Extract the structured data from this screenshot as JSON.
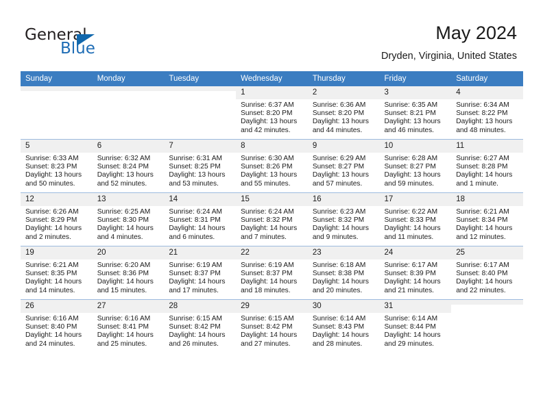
{
  "brand": {
    "name_top": "General",
    "name_bottom": "Blue",
    "accent_color": "#1168ad"
  },
  "header": {
    "month_title": "May 2024",
    "location": "Dryden, Virginia, United States",
    "header_bg": "#3b7dc1"
  },
  "weekdays": [
    "Sunday",
    "Monday",
    "Tuesday",
    "Wednesday",
    "Thursday",
    "Friday",
    "Saturday"
  ],
  "labels": {
    "sunrise": "Sunrise:",
    "sunset": "Sunset:",
    "daylight": "Daylight:"
  },
  "weeks": [
    [
      {
        "day": "",
        "sunrise": "",
        "sunset": "",
        "daylight": "",
        "empty": true
      },
      {
        "day": "",
        "sunrise": "",
        "sunset": "",
        "daylight": "",
        "empty": true
      },
      {
        "day": "",
        "sunrise": "",
        "sunset": "",
        "daylight": "",
        "empty": true
      },
      {
        "day": "1",
        "sunrise": "Sunrise: 6:37 AM",
        "sunset": "Sunset: 8:20 PM",
        "daylight": "Daylight: 13 hours and 42 minutes."
      },
      {
        "day": "2",
        "sunrise": "Sunrise: 6:36 AM",
        "sunset": "Sunset: 8:20 PM",
        "daylight": "Daylight: 13 hours and 44 minutes."
      },
      {
        "day": "3",
        "sunrise": "Sunrise: 6:35 AM",
        "sunset": "Sunset: 8:21 PM",
        "daylight": "Daylight: 13 hours and 46 minutes."
      },
      {
        "day": "4",
        "sunrise": "Sunrise: 6:34 AM",
        "sunset": "Sunset: 8:22 PM",
        "daylight": "Daylight: 13 hours and 48 minutes."
      }
    ],
    [
      {
        "day": "5",
        "sunrise": "Sunrise: 6:33 AM",
        "sunset": "Sunset: 8:23 PM",
        "daylight": "Daylight: 13 hours and 50 minutes."
      },
      {
        "day": "6",
        "sunrise": "Sunrise: 6:32 AM",
        "sunset": "Sunset: 8:24 PM",
        "daylight": "Daylight: 13 hours and 52 minutes."
      },
      {
        "day": "7",
        "sunrise": "Sunrise: 6:31 AM",
        "sunset": "Sunset: 8:25 PM",
        "daylight": "Daylight: 13 hours and 53 minutes."
      },
      {
        "day": "8",
        "sunrise": "Sunrise: 6:30 AM",
        "sunset": "Sunset: 8:26 PM",
        "daylight": "Daylight: 13 hours and 55 minutes."
      },
      {
        "day": "9",
        "sunrise": "Sunrise: 6:29 AM",
        "sunset": "Sunset: 8:27 PM",
        "daylight": "Daylight: 13 hours and 57 minutes."
      },
      {
        "day": "10",
        "sunrise": "Sunrise: 6:28 AM",
        "sunset": "Sunset: 8:27 PM",
        "daylight": "Daylight: 13 hours and 59 minutes."
      },
      {
        "day": "11",
        "sunrise": "Sunrise: 6:27 AM",
        "sunset": "Sunset: 8:28 PM",
        "daylight": "Daylight: 14 hours and 1 minute."
      }
    ],
    [
      {
        "day": "12",
        "sunrise": "Sunrise: 6:26 AM",
        "sunset": "Sunset: 8:29 PM",
        "daylight": "Daylight: 14 hours and 2 minutes."
      },
      {
        "day": "13",
        "sunrise": "Sunrise: 6:25 AM",
        "sunset": "Sunset: 8:30 PM",
        "daylight": "Daylight: 14 hours and 4 minutes."
      },
      {
        "day": "14",
        "sunrise": "Sunrise: 6:24 AM",
        "sunset": "Sunset: 8:31 PM",
        "daylight": "Daylight: 14 hours and 6 minutes."
      },
      {
        "day": "15",
        "sunrise": "Sunrise: 6:24 AM",
        "sunset": "Sunset: 8:32 PM",
        "daylight": "Daylight: 14 hours and 7 minutes."
      },
      {
        "day": "16",
        "sunrise": "Sunrise: 6:23 AM",
        "sunset": "Sunset: 8:32 PM",
        "daylight": "Daylight: 14 hours and 9 minutes."
      },
      {
        "day": "17",
        "sunrise": "Sunrise: 6:22 AM",
        "sunset": "Sunset: 8:33 PM",
        "daylight": "Daylight: 14 hours and 11 minutes."
      },
      {
        "day": "18",
        "sunrise": "Sunrise: 6:21 AM",
        "sunset": "Sunset: 8:34 PM",
        "daylight": "Daylight: 14 hours and 12 minutes."
      }
    ],
    [
      {
        "day": "19",
        "sunrise": "Sunrise: 6:21 AM",
        "sunset": "Sunset: 8:35 PM",
        "daylight": "Daylight: 14 hours and 14 minutes."
      },
      {
        "day": "20",
        "sunrise": "Sunrise: 6:20 AM",
        "sunset": "Sunset: 8:36 PM",
        "daylight": "Daylight: 14 hours and 15 minutes."
      },
      {
        "day": "21",
        "sunrise": "Sunrise: 6:19 AM",
        "sunset": "Sunset: 8:37 PM",
        "daylight": "Daylight: 14 hours and 17 minutes."
      },
      {
        "day": "22",
        "sunrise": "Sunrise: 6:19 AM",
        "sunset": "Sunset: 8:37 PM",
        "daylight": "Daylight: 14 hours and 18 minutes."
      },
      {
        "day": "23",
        "sunrise": "Sunrise: 6:18 AM",
        "sunset": "Sunset: 8:38 PM",
        "daylight": "Daylight: 14 hours and 20 minutes."
      },
      {
        "day": "24",
        "sunrise": "Sunrise: 6:17 AM",
        "sunset": "Sunset: 8:39 PM",
        "daylight": "Daylight: 14 hours and 21 minutes."
      },
      {
        "day": "25",
        "sunrise": "Sunrise: 6:17 AM",
        "sunset": "Sunset: 8:40 PM",
        "daylight": "Daylight: 14 hours and 22 minutes."
      }
    ],
    [
      {
        "day": "26",
        "sunrise": "Sunrise: 6:16 AM",
        "sunset": "Sunset: 8:40 PM",
        "daylight": "Daylight: 14 hours and 24 minutes."
      },
      {
        "day": "27",
        "sunrise": "Sunrise: 6:16 AM",
        "sunset": "Sunset: 8:41 PM",
        "daylight": "Daylight: 14 hours and 25 minutes."
      },
      {
        "day": "28",
        "sunrise": "Sunrise: 6:15 AM",
        "sunset": "Sunset: 8:42 PM",
        "daylight": "Daylight: 14 hours and 26 minutes."
      },
      {
        "day": "29",
        "sunrise": "Sunrise: 6:15 AM",
        "sunset": "Sunset: 8:42 PM",
        "daylight": "Daylight: 14 hours and 27 minutes."
      },
      {
        "day": "30",
        "sunrise": "Sunrise: 6:14 AM",
        "sunset": "Sunset: 8:43 PM",
        "daylight": "Daylight: 14 hours and 28 minutes."
      },
      {
        "day": "31",
        "sunrise": "Sunrise: 6:14 AM",
        "sunset": "Sunset: 8:44 PM",
        "daylight": "Daylight: 14 hours and 29 minutes."
      },
      {
        "day": "",
        "sunrise": "",
        "sunset": "",
        "daylight": "",
        "empty": true
      }
    ]
  ]
}
